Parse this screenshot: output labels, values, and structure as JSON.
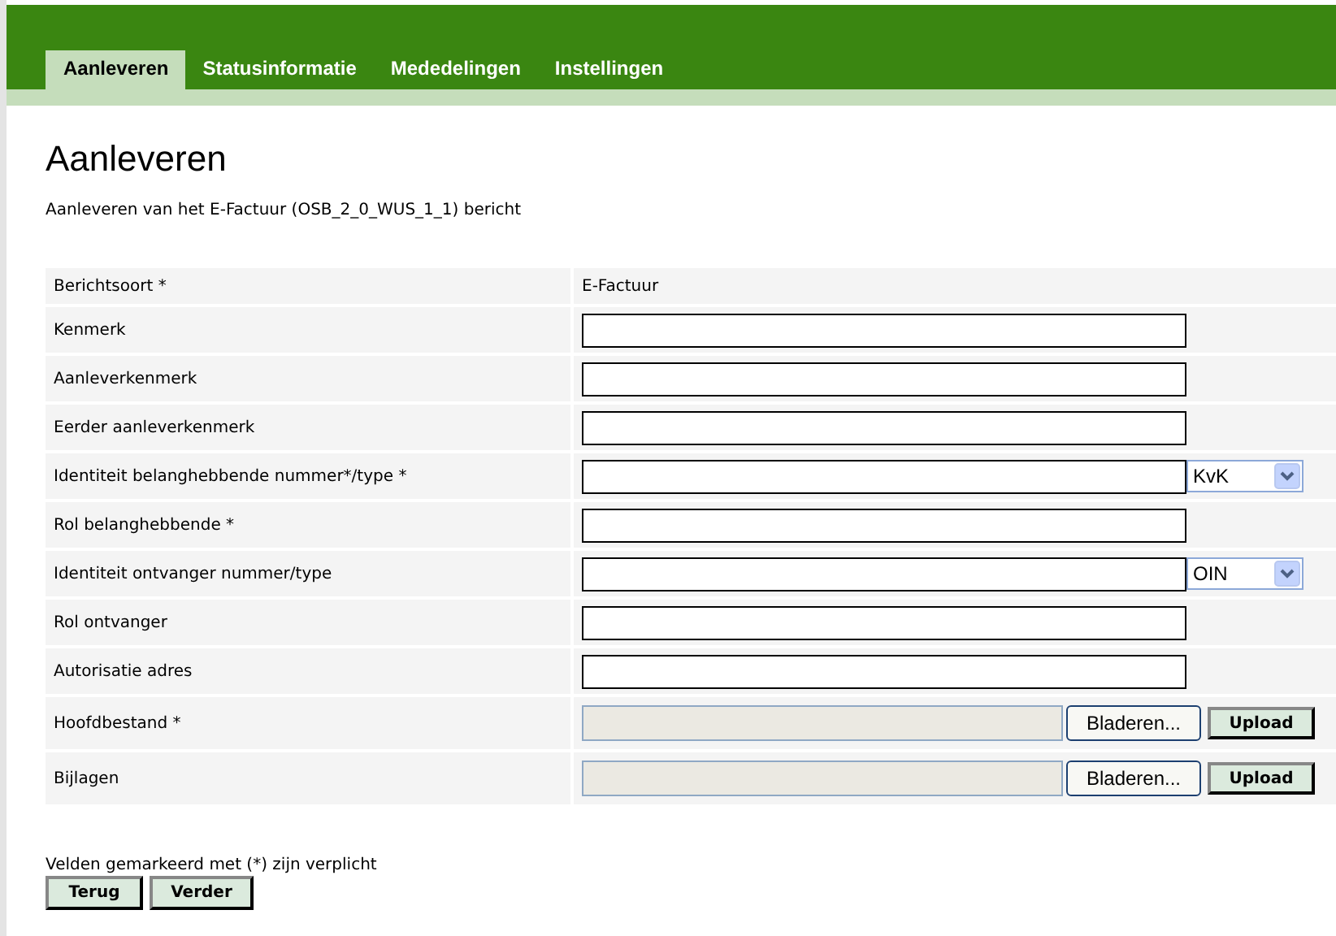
{
  "tabs": [
    {
      "label": "Aanleveren",
      "selected": true
    },
    {
      "label": "Statusinformatie",
      "selected": false
    },
    {
      "label": "Mededelingen",
      "selected": false
    },
    {
      "label": "Instellingen",
      "selected": false
    }
  ],
  "title": "Aanleveren",
  "intro": "Aanleveren van het E-Factuur (OSB_2_0_WUS_1_1) bericht",
  "rows": [
    {
      "label": "Berichtsoort *",
      "kind": "static",
      "value": "E-Factuur"
    },
    {
      "label": "Kenmerk",
      "kind": "text"
    },
    {
      "label": "Aanleverkenmerk",
      "kind": "text"
    },
    {
      "label": "Eerder aanleverkenmerk",
      "kind": "text"
    },
    {
      "label": "Identiteit belanghebbende nummer*/type *",
      "kind": "select",
      "option": "KvK"
    },
    {
      "label": "Rol belanghebbende *",
      "kind": "text"
    },
    {
      "label": "Identiteit ontvanger nummer/type",
      "kind": "select",
      "option": "OIN"
    },
    {
      "label": "Rol ontvanger",
      "kind": "text"
    },
    {
      "label": "Autorisatie adres",
      "kind": "text"
    },
    {
      "label": "Hoofdbestand *",
      "kind": "file",
      "browse": "Bladeren...",
      "upload": "Upload"
    },
    {
      "label": "Bijlagen",
      "kind": "file",
      "browse": "Bladeren...",
      "upload": "Upload"
    }
  ],
  "note": "Velden gemarkeerd met (*) zijn verplicht",
  "buttons": [
    "Terug",
    "Verder"
  ]
}
